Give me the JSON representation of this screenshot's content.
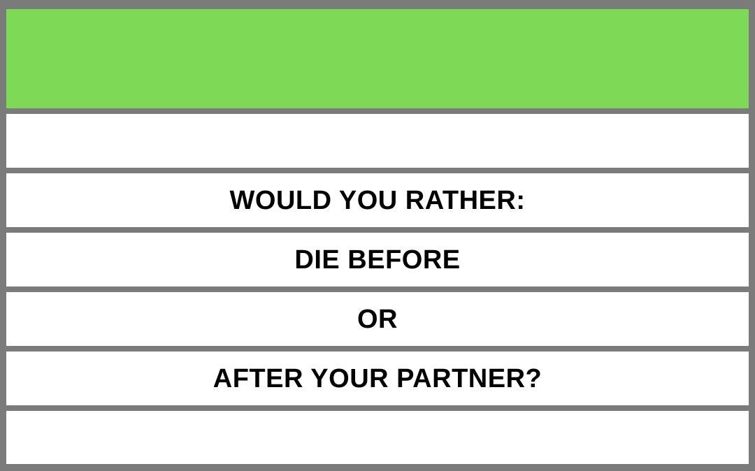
{
  "colors": {
    "header_fill": "#7ed957",
    "frame": "#7b7b7b",
    "row_fill": "#ffffff",
    "text": "#000000"
  },
  "rows": [
    {
      "text": ""
    },
    {
      "text": "WOULD YOU RATHER:"
    },
    {
      "text": "DIE BEFORE"
    },
    {
      "text": "OR"
    },
    {
      "text": "AFTER YOUR PARTNER?"
    },
    {
      "text": ""
    }
  ]
}
